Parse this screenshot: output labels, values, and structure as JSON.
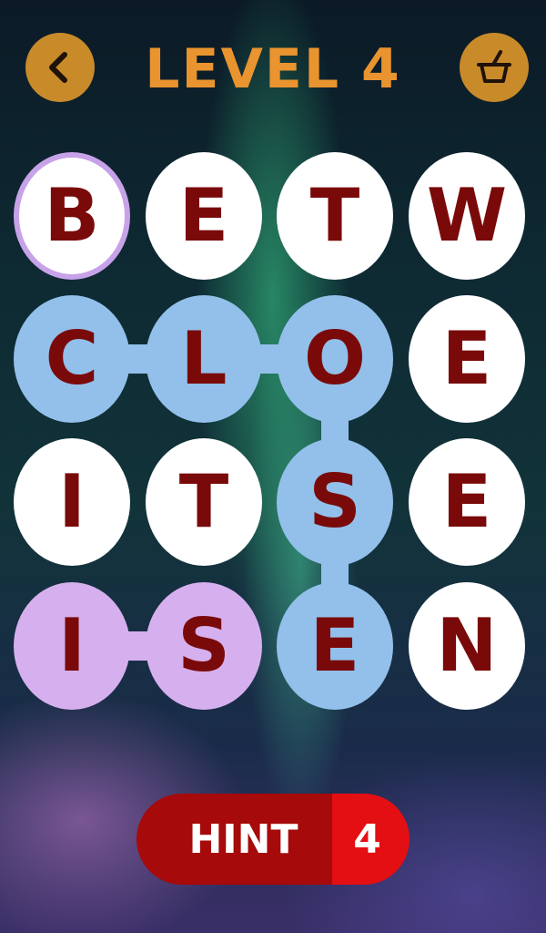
{
  "header": {
    "title": "LEVEL 4",
    "back_icon": "chevron-left-icon",
    "shop_icon": "basket-icon",
    "accent_color": "#e9942f"
  },
  "grid": {
    "rows": [
      [
        "B",
        "E",
        "T",
        "W"
      ],
      [
        "C",
        "L",
        "O",
        "E"
      ],
      [
        "I",
        "T",
        "S",
        "E"
      ],
      [
        "I",
        "S",
        "E",
        "N"
      ]
    ],
    "found_word_path_color": "#92c0ea",
    "current_selection_color": "#d6b0ee",
    "letter_color": "#7a0a0a"
  },
  "hint": {
    "label": "HINT",
    "count": "4"
  }
}
